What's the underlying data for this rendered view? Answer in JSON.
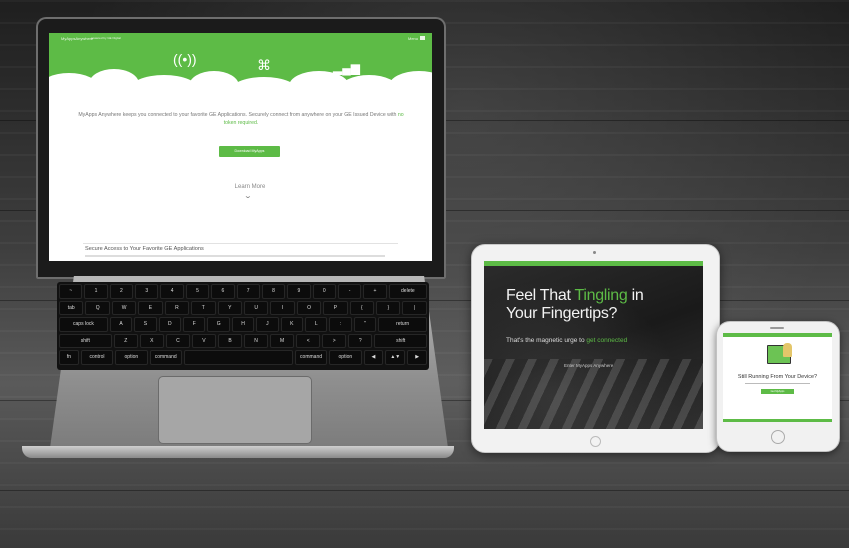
{
  "laptop": {
    "nav": {
      "brand": "MyAppsAnywhere",
      "tagline": "powered by GE Digital",
      "menu_label": "Menu"
    },
    "hero_icons": [
      "share-icon",
      "wifi-tower-icon",
      "satellite-icon",
      "signal-bars-icon"
    ],
    "intro_text": "MyApps Anywhere keeps you connected to your favorite GE Applications. Securely connect from anywhere on your GE Issued Device with",
    "intro_highlight": "no token required.",
    "download_button": "Download MyApps",
    "learn_more": "Learn More",
    "section_title": "Secure Access to Your Favorite GE Applications",
    "keyboard_rows": [
      [
        "~",
        "1",
        "2",
        "3",
        "4",
        "5",
        "6",
        "7",
        "8",
        "9",
        "0",
        "-",
        "+",
        "delete"
      ],
      [
        "tab",
        "Q",
        "W",
        "E",
        "R",
        "T",
        "Y",
        "U",
        "I",
        "O",
        "P",
        "{",
        "}",
        "|"
      ],
      [
        "caps lock",
        "A",
        "S",
        "D",
        "F",
        "G",
        "H",
        "J",
        "K",
        "L",
        ":",
        "\"",
        "return"
      ],
      [
        "shift",
        "Z",
        "X",
        "C",
        "V",
        "B",
        "N",
        "M",
        "<",
        ">",
        "?",
        "shift"
      ],
      [
        "fn",
        "control",
        "option",
        "command",
        "",
        "command",
        "option",
        "◀",
        "▲▼",
        "▶"
      ]
    ]
  },
  "tablet": {
    "headline_1": "Feel That ",
    "headline_1_hl": "Tingling",
    "headline_1_end": " in",
    "headline_2": "Your Fingertips?",
    "sub_text": "That's the magnetic urge to ",
    "sub_highlight": "get connected",
    "link_text": "Enter MyApps Anywhere"
  },
  "phone": {
    "title": "Still Running From Your Device?",
    "button": "Get MyApps"
  },
  "colors": {
    "accent": "#5dbb46",
    "background": "#2a2a2a"
  }
}
